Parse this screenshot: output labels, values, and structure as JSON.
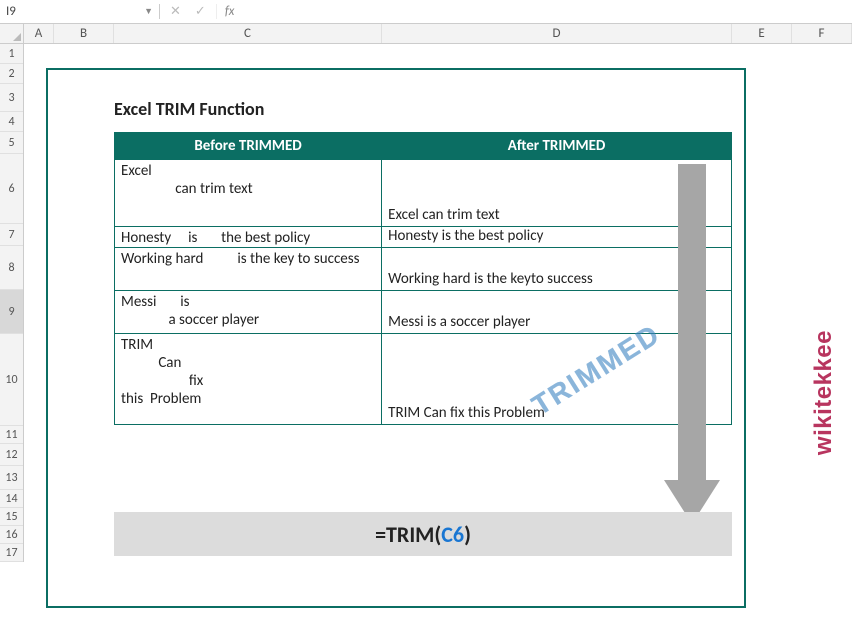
{
  "namebox": "I9",
  "fx_label": "fx",
  "columns": [
    "A",
    "B",
    "C",
    "D",
    "E",
    "F"
  ],
  "rows": [
    "1",
    "2",
    "3",
    "4",
    "5",
    "6",
    "7",
    "8",
    "9",
    "10",
    "11",
    "12",
    "13",
    "14",
    "15",
    "16",
    "17"
  ],
  "title": "Excel TRIM Function",
  "headers": {
    "left": "Before TRIMMED",
    "right": "After TRIMMED"
  },
  "data": [
    {
      "before": "Excel\n                can trim text",
      "after": "Excel can trim text"
    },
    {
      "before": "Honesty     is       the best policy",
      "after": "Honesty is the best policy"
    },
    {
      "before": "Working hard          is the key to success",
      "after": "Working hard is the keyto success"
    },
    {
      "before": "Messi       is\n              a soccer player",
      "after": "Messi is a soccer player"
    },
    {
      "before": "TRIM\n           Can\n                    fix\nthis  Problem",
      "after": "TRIM Can fix this Problem"
    }
  ],
  "formula": {
    "prefix": "=TRIM(",
    "ref": "C6",
    "suffix": ")"
  },
  "stamp": "TRIMMED",
  "watermark": "wikitekkee"
}
